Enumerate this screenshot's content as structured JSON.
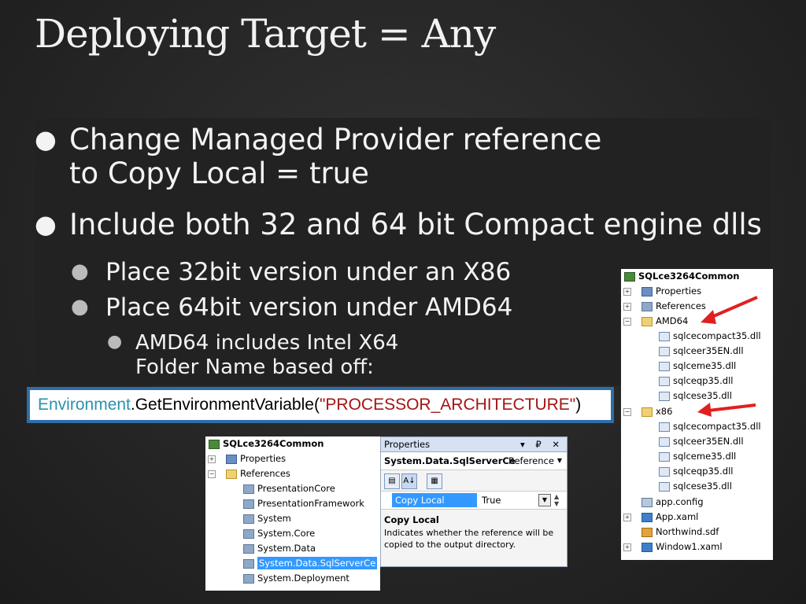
{
  "title": "Deploying Target = Any",
  "bullets": {
    "b1_line1": "Change Managed Provider reference",
    "b1_line2": "to Copy Local = true",
    "b2": "Include both 32 and 64 bit Compact engine dlls",
    "sub1": "Place 32bit version under an X86",
    "sub2": "Place 64bit version under AMD64",
    "subsub_line1": "AMD64 includes Intel X64",
    "subsub_line2": "Folder Name based off:"
  },
  "code": {
    "class": "Environment",
    "method": ".GetEnvironmentVariable(",
    "string": "\"PROCESSOR_ARCHITECTURE\"",
    "close": ")"
  },
  "solution_right": {
    "project": "SQLce3264Common",
    "items": [
      "Properties",
      "References",
      "AMD64",
      "sqlcecompact35.dll",
      "sqlceer35EN.dll",
      "sqlceme35.dll",
      "sqlceqp35.dll",
      "sqlcese35.dll",
      "x86",
      "sqlcecompact35.dll",
      "sqlceer35EN.dll",
      "sqlceme35.dll",
      "sqlceqp35.dll",
      "sqlcese35.dll",
      "app.config",
      "App.xaml",
      "Northwind.sdf",
      "Window1.xaml"
    ]
  },
  "solution_left": {
    "project": "SQLce3264Common",
    "items": [
      "Properties",
      "References",
      "PresentationCore",
      "PresentationFramework",
      "System",
      "System.Core",
      "System.Data",
      "System.Data.SqlServerCe",
      "System.Deployment"
    ]
  },
  "properties": {
    "title": "Properties",
    "controls": "▾ ₽ ✕",
    "object": "System.Data.SqlServerCe",
    "object_type": "Reference",
    "row_name": "Copy Local",
    "row_value": "True",
    "desc_title": "Copy Local",
    "desc_text": "Indicates whether the reference will be copied to the output directory."
  },
  "colors": {
    "code_class": "#2b91af",
    "code_string": "#a31515",
    "code_border": "#2e6ea8",
    "selection": "#3399ff",
    "arrow": "#e02020"
  }
}
